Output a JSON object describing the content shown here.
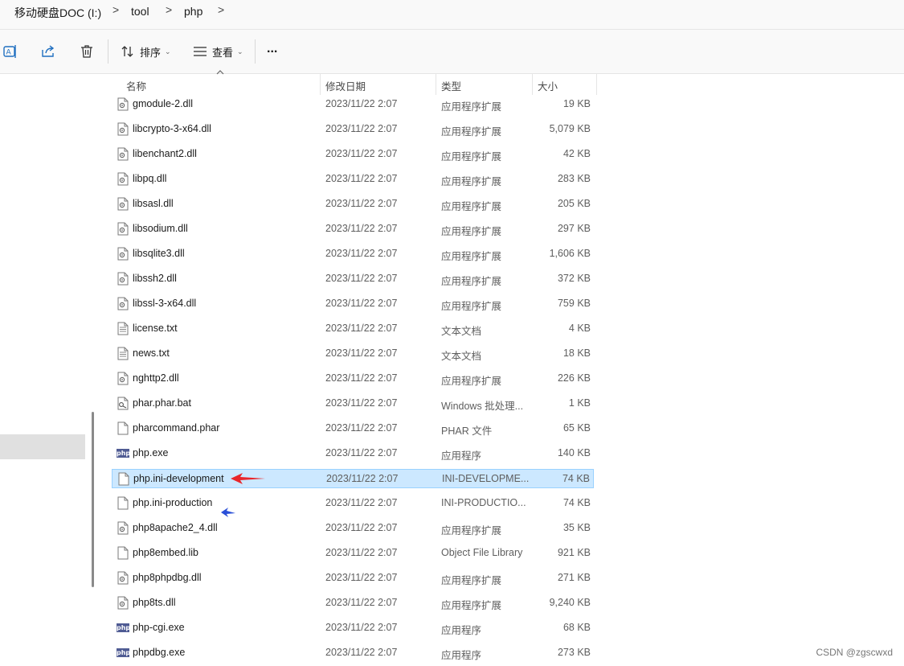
{
  "breadcrumb": {
    "items": [
      "移动硬盘DOC (I:)",
      "tool",
      "php"
    ],
    "separator": ">"
  },
  "toolbar": {
    "sort_label": "排序",
    "view_label": "查看",
    "more_label": "..."
  },
  "columns": {
    "name": "名称",
    "date": "修改日期",
    "type": "类型",
    "size": "大小"
  },
  "files": [
    {
      "name": "gmodule-2.dll",
      "date": "2023/11/22 2:07",
      "type": "应用程序扩展",
      "size": "19 KB",
      "icon": "dll-icon"
    },
    {
      "name": "libcrypto-3-x64.dll",
      "date": "2023/11/22 2:07",
      "type": "应用程序扩展",
      "size": "5,079 KB",
      "icon": "dll-icon"
    },
    {
      "name": "libenchant2.dll",
      "date": "2023/11/22 2:07",
      "type": "应用程序扩展",
      "size": "42 KB",
      "icon": "dll-icon"
    },
    {
      "name": "libpq.dll",
      "date": "2023/11/22 2:07",
      "type": "应用程序扩展",
      "size": "283 KB",
      "icon": "dll-icon"
    },
    {
      "name": "libsasl.dll",
      "date": "2023/11/22 2:07",
      "type": "应用程序扩展",
      "size": "205 KB",
      "icon": "dll-icon"
    },
    {
      "name": "libsodium.dll",
      "date": "2023/11/22 2:07",
      "type": "应用程序扩展",
      "size": "297 KB",
      "icon": "dll-icon"
    },
    {
      "name": "libsqlite3.dll",
      "date": "2023/11/22 2:07",
      "type": "应用程序扩展",
      "size": "1,606 KB",
      "icon": "dll-icon"
    },
    {
      "name": "libssh2.dll",
      "date": "2023/11/22 2:07",
      "type": "应用程序扩展",
      "size": "372 KB",
      "icon": "dll-icon"
    },
    {
      "name": "libssl-3-x64.dll",
      "date": "2023/11/22 2:07",
      "type": "应用程序扩展",
      "size": "759 KB",
      "icon": "dll-icon"
    },
    {
      "name": "license.txt",
      "date": "2023/11/22 2:07",
      "type": "文本文档",
      "size": "4 KB",
      "icon": "text-file-icon"
    },
    {
      "name": "news.txt",
      "date": "2023/11/22 2:07",
      "type": "文本文档",
      "size": "18 KB",
      "icon": "text-file-icon"
    },
    {
      "name": "nghttp2.dll",
      "date": "2023/11/22 2:07",
      "type": "应用程序扩展",
      "size": "226 KB",
      "icon": "dll-icon"
    },
    {
      "name": "phar.phar.bat",
      "date": "2023/11/22 2:07",
      "type": "Windows 批处理...",
      "size": "1 KB",
      "icon": "batch-file-icon"
    },
    {
      "name": "pharcommand.phar",
      "date": "2023/11/22 2:07",
      "type": "PHAR 文件",
      "size": "65 KB",
      "icon": "blank-file-icon"
    },
    {
      "name": "php.exe",
      "date": "2023/11/22 2:07",
      "type": "应用程序",
      "size": "140 KB",
      "icon": "php-exe-icon"
    },
    {
      "name": "php.ini-development",
      "date": "2023/11/22 2:07",
      "type": "INI-DEVELOPME...",
      "size": "74 KB",
      "icon": "blank-file-icon",
      "selected": true
    },
    {
      "name": "php.ini-production",
      "date": "2023/11/22 2:07",
      "type": "INI-PRODUCTIO...",
      "size": "74 KB",
      "icon": "blank-file-icon"
    },
    {
      "name": "php8apache2_4.dll",
      "date": "2023/11/22 2:07",
      "type": "应用程序扩展",
      "size": "35 KB",
      "icon": "dll-icon"
    },
    {
      "name": "php8embed.lib",
      "date": "2023/11/22 2:07",
      "type": "Object File Library",
      "size": "921 KB",
      "icon": "blank-file-icon"
    },
    {
      "name": "php8phpdbg.dll",
      "date": "2023/11/22 2:07",
      "type": "应用程序扩展",
      "size": "271 KB",
      "icon": "dll-icon"
    },
    {
      "name": "php8ts.dll",
      "date": "2023/11/22 2:07",
      "type": "应用程序扩展",
      "size": "9,240 KB",
      "icon": "dll-icon"
    },
    {
      "name": "php-cgi.exe",
      "date": "2023/11/22 2:07",
      "type": "应用程序",
      "size": "68 KB",
      "icon": "php-exe-icon"
    },
    {
      "name": "phpdbg.exe",
      "date": "2023/11/22 2:07",
      "type": "应用程序",
      "size": "273 KB",
      "icon": "php-exe-icon"
    }
  ],
  "php_icon_text": "php",
  "annotations": {
    "red_arrow_color": "#e8262b",
    "blue_arrow_color": "#2a4fd8"
  },
  "watermark": "CSDN @zgscwxd",
  "colors": {
    "selected_row_bg": "#cce8ff",
    "selected_row_border": "#99d1ff",
    "php_icon_bg": "#4f5b93"
  }
}
